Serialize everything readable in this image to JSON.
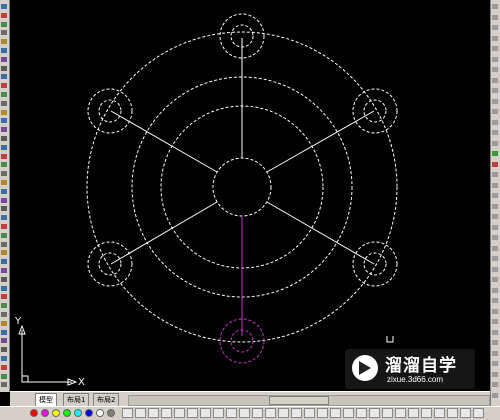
{
  "layout_tabs": [
    {
      "label": "模型",
      "active": true
    },
    {
      "label": "布局1",
      "active": false
    },
    {
      "label": "布局2",
      "active": false
    }
  ],
  "ucs": {
    "x_label": "X",
    "y_label": "Y"
  },
  "watermark": {
    "title": "溜溜自学",
    "url": "zixue.3d66.com"
  },
  "colors": {
    "canvas": "#000000",
    "lines": "#ffffff",
    "highlight": "#cc33cc",
    "toolbar": "#d4d0c8"
  },
  "icons": [
    "ucs-icon",
    "watermark-logo-icon"
  ]
}
